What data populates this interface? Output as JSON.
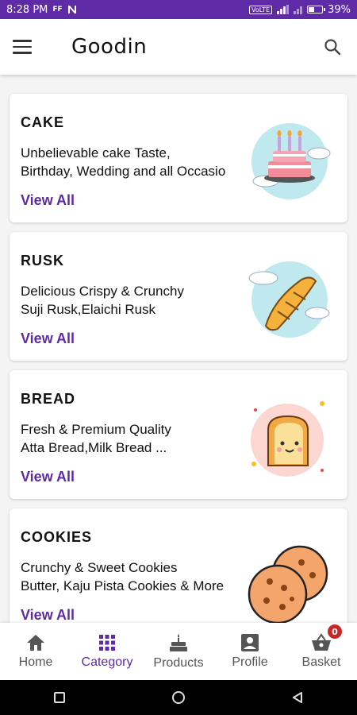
{
  "status_bar": {
    "time": "8:28 PM",
    "indicators": "FF",
    "network": "VoLTE",
    "battery": "39%",
    "battery_level": 0.39
  },
  "appbar": {
    "title": "Goodin",
    "menu_icon": "hamburger-icon",
    "search_icon": "search-icon"
  },
  "categories": [
    {
      "title": "CAKE",
      "line1": "Unbelievable cake Taste,",
      "line2": "Birthday, Wedding and all Occasio",
      "link": "View All",
      "icon": "cake-illustration"
    },
    {
      "title": "RUSK",
      "line1": "Delicious Crispy & Crunchy",
      "line2": "Suji Rusk,Elaichi Rusk",
      "link": "View All",
      "icon": "croissant-illustration"
    },
    {
      "title": "BREAD",
      "line1": "Fresh & Premium Quality",
      "line2": "Atta Bread,Milk Bread ...",
      "link": "View All",
      "icon": "toast-illustration"
    },
    {
      "title": "COOKIES",
      "line1": "Crunchy & Sweet Cookies",
      "line2": "Butter, Kaju Pista Cookies & More",
      "link": "View All",
      "icon": "cookies-illustration"
    }
  ],
  "bottom_nav": [
    {
      "label": "Home",
      "icon": "home-icon",
      "active": false
    },
    {
      "label": "Category",
      "icon": "grid-icon",
      "active": true
    },
    {
      "label": "Products",
      "icon": "cake-icon",
      "active": false
    },
    {
      "label": "Profile",
      "icon": "profile-icon",
      "active": false
    },
    {
      "label": "Basket",
      "icon": "basket-icon",
      "active": false,
      "badge": "0"
    }
  ],
  "colors": {
    "primary": "#5e2aa5",
    "badge": "#c62828",
    "inactive": "#555555"
  }
}
